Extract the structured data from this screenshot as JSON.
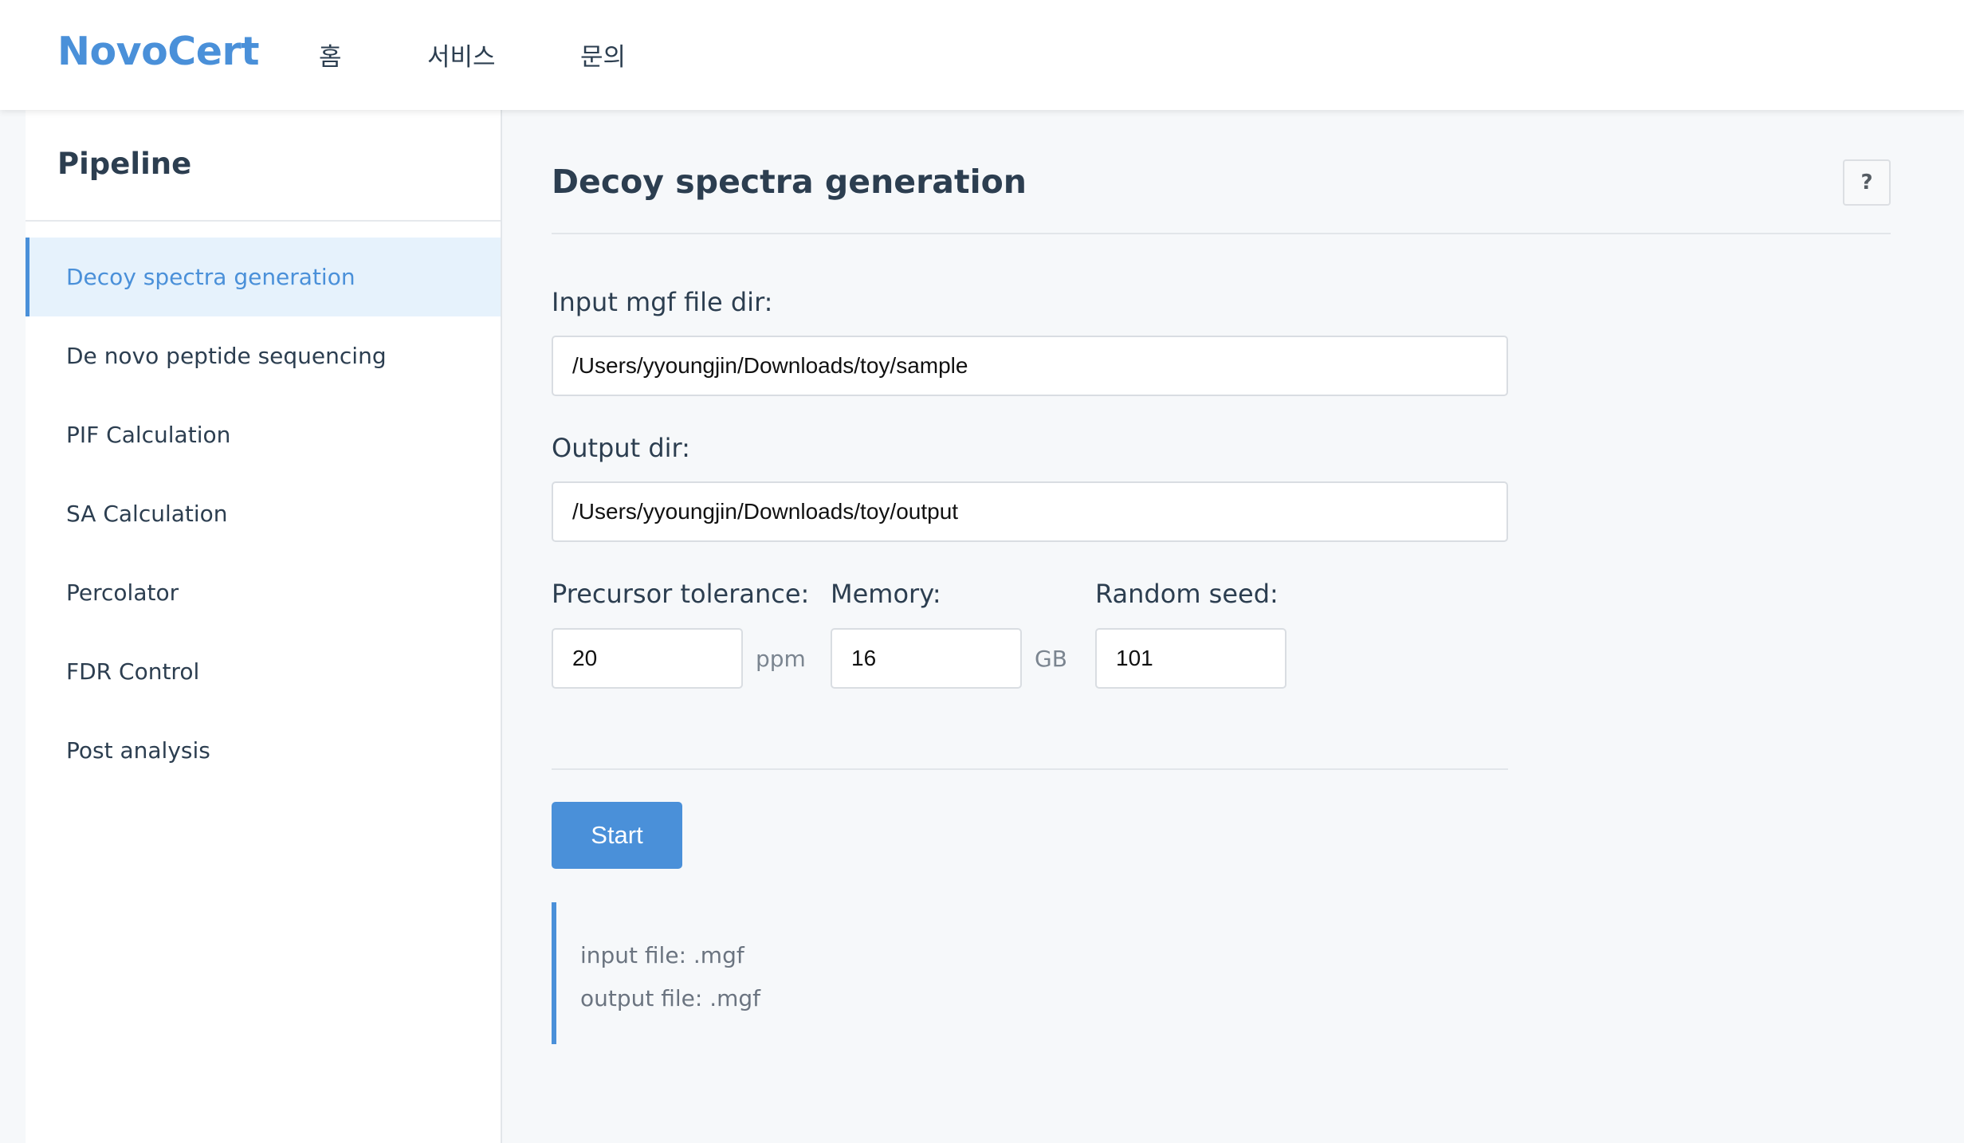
{
  "header": {
    "brand": "NovoCert",
    "nav": [
      {
        "label": "홈"
      },
      {
        "label": "서비스"
      },
      {
        "label": "문의"
      }
    ]
  },
  "sidebar": {
    "title": "Pipeline",
    "items": [
      {
        "label": "Decoy spectra generation",
        "active": true
      },
      {
        "label": "De novo peptide sequencing",
        "active": false
      },
      {
        "label": "PIF Calculation",
        "active": false
      },
      {
        "label": "SA Calculation",
        "active": false
      },
      {
        "label": "Percolator",
        "active": false
      },
      {
        "label": "FDR Control",
        "active": false
      },
      {
        "label": "Post analysis",
        "active": false
      }
    ]
  },
  "main": {
    "title": "Decoy spectra generation",
    "help_label": "?",
    "input_dir": {
      "label": "Input mgf file dir:",
      "value": "/Users/yyoungjin/Downloads/toy/sample"
    },
    "output_dir": {
      "label": "Output dir:",
      "value": "/Users/yyoungjin/Downloads/toy/output"
    },
    "precursor_tolerance": {
      "label": "Precursor tolerance:",
      "value": "20",
      "unit": "ppm"
    },
    "memory": {
      "label": "Memory:",
      "value": "16",
      "unit": "GB"
    },
    "random_seed": {
      "label": "Random seed:",
      "value": "101"
    },
    "start_label": "Start",
    "info": {
      "input_file": "input file: .mgf",
      "output_file": "output file: .mgf"
    }
  },
  "colors": {
    "accent": "#4a90d9",
    "active_bg": "#e6f2fc",
    "page_bg": "#f6f8fa",
    "text": "#2c3e50",
    "muted": "#6b7480"
  }
}
